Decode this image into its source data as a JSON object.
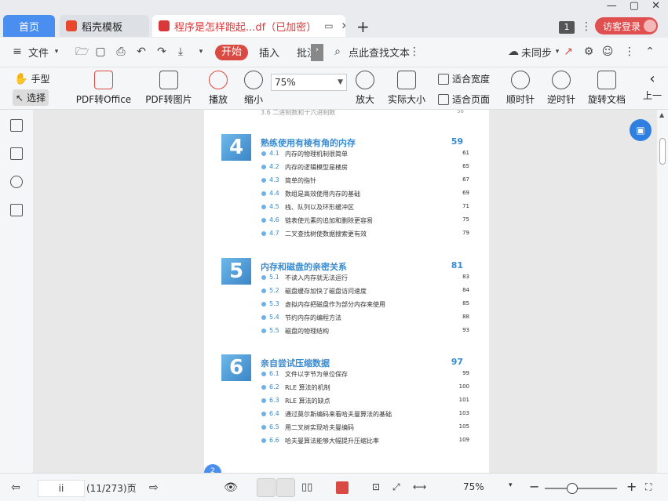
{
  "window": {
    "controls": [
      "—",
      "▢",
      "✕"
    ]
  },
  "tabs": {
    "home": "首页",
    "items": [
      {
        "label": "稻壳模板"
      },
      {
        "label": "程序是怎样跑起...df（已加密）"
      }
    ],
    "badge_count": "1",
    "login": "访客登录"
  },
  "menu": {
    "file": "文件",
    "start": "开始",
    "insert": "插入",
    "annotate": "批注",
    "search": "点此查找文本",
    "sync": "未同步"
  },
  "ribbon": {
    "hand": "手型",
    "select": "选择",
    "pdf_to_office": "PDF转Office",
    "pdf_to_image": "PDF转图片",
    "play": "播放",
    "zoom_out": "缩小",
    "zoom_value": "75%",
    "zoom_in": "放大",
    "actual_size": "实际大小",
    "fit_width": "适合宽度",
    "fit_page": "适合页面",
    "rotate_cw": "顺时针",
    "rotate_ccw": "逆时针",
    "rotate_doc": "旋转文档",
    "prev": "上一"
  },
  "document": {
    "prev_line": "3.6  二进制数和十六进制数",
    "prev_page": "56",
    "chapters": [
      {
        "num": "4",
        "title": "熟练使用有棱有角的内存",
        "page": "59",
        "sections": [
          {
            "no": "4.1",
            "title": "内存的物理机制很简单",
            "page": "61"
          },
          {
            "no": "4.2",
            "title": "内存的逻辑模型是楼房",
            "page": "65"
          },
          {
            "no": "4.3",
            "title": "简单的指针",
            "page": "67"
          },
          {
            "no": "4.4",
            "title": "数组是高效使用内存的基础",
            "page": "69"
          },
          {
            "no": "4.5",
            "title": "栈、队列以及环形缓冲区",
            "page": "71"
          },
          {
            "no": "4.6",
            "title": "链表使元素的追加和删除更容易",
            "page": "75"
          },
          {
            "no": "4.7",
            "title": "二叉查找树使数据搜索更有效",
            "page": "79"
          }
        ]
      },
      {
        "num": "5",
        "title": "内存和磁盘的亲密关系",
        "page": "81",
        "sections": [
          {
            "no": "5.1",
            "title": "不读入内存就无法运行",
            "page": "83"
          },
          {
            "no": "5.2",
            "title": "磁盘缓存加快了磁盘访问速度",
            "page": "84"
          },
          {
            "no": "5.3",
            "title": "虚拟内存把磁盘作为部分内存来使用",
            "page": "85"
          },
          {
            "no": "5.4",
            "title": "节约内存的编程方法",
            "page": "88"
          },
          {
            "no": "5.5",
            "title": "磁盘的物理结构",
            "page": "93"
          }
        ]
      },
      {
        "num": "6",
        "title": "亲自尝试压缩数据",
        "page": "97",
        "sections": [
          {
            "no": "6.1",
            "title": "文件以字节为单位保存",
            "page": "99"
          },
          {
            "no": "6.2",
            "title": "RLE 算法的机制",
            "page": "100"
          },
          {
            "no": "6.3",
            "title": "RLE 算法的缺点",
            "page": "101"
          },
          {
            "no": "6.4",
            "title": "通过莫尔斯编码来看哈夫曼算法的基础",
            "page": "103"
          },
          {
            "no": "6.5",
            "title": "用二叉树实现哈夫曼编码",
            "page": "105"
          },
          {
            "no": "6.6",
            "title": "哈夫曼算法能够大幅提升压缩比率",
            "page": "109"
          }
        ]
      }
    ],
    "page_badge": "2"
  },
  "status": {
    "page_input": "ii",
    "page_info": "(11/273)页",
    "zoom": "75%",
    "zoom_level": 0.36
  },
  "colors": {
    "accent": "#4a8ff0",
    "brand_red": "#d94a42",
    "toc_blue": "#3a8bd0"
  }
}
